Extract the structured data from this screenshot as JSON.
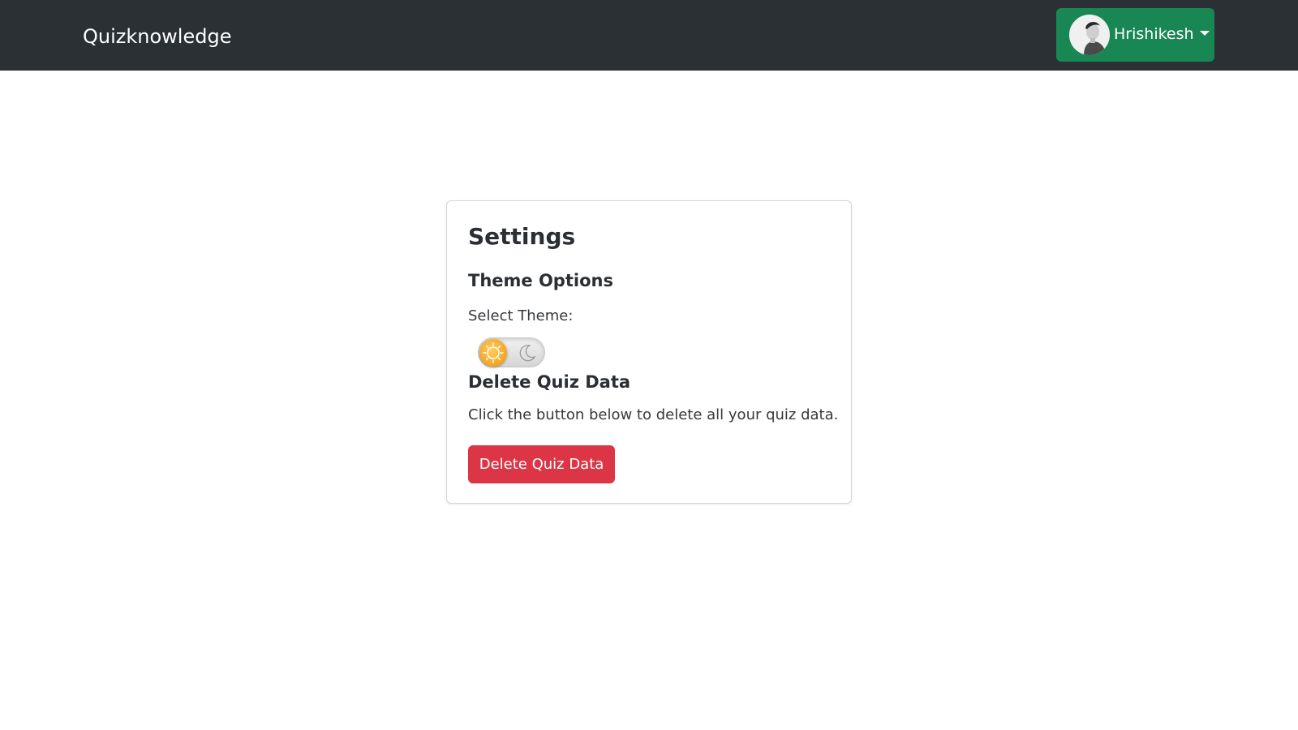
{
  "navbar": {
    "brand": "Quizknowledge",
    "user": {
      "name": "Hrishikesh",
      "avatar_icon": "user-avatar-photo",
      "dropdown_icon": "caret-down-icon"
    },
    "colors": {
      "background": "#2b3035",
      "user_button": "#198754"
    }
  },
  "settings": {
    "title": "Settings",
    "theme": {
      "heading": "Theme Options",
      "select_label": "Select Theme:",
      "toggle_state": "light",
      "light_icon": "sun-icon",
      "dark_icon": "moon-icon"
    },
    "delete": {
      "heading": "Delete Quiz Data",
      "description": "Click the button below to delete all your quiz data.",
      "button_label": "Delete Quiz Data",
      "button_color": "#dc3545"
    }
  }
}
